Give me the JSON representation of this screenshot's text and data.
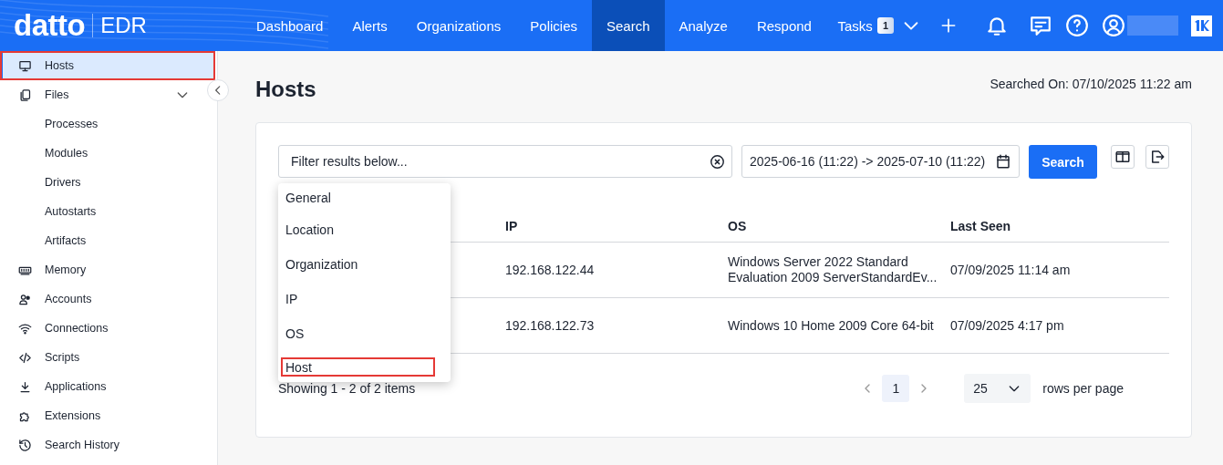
{
  "brand": {
    "logo": "datto",
    "product": "EDR"
  },
  "nav": [
    {
      "label": "Dashboard",
      "selected": false
    },
    {
      "label": "Alerts",
      "selected": false
    },
    {
      "label": "Organizations",
      "selected": false
    },
    {
      "label": "Policies",
      "selected": false
    },
    {
      "label": "Search",
      "selected": true
    },
    {
      "label": "Analyze",
      "selected": false
    },
    {
      "label": "Respond",
      "selected": false
    }
  ],
  "tasks": {
    "label": "Tasks",
    "count": "1"
  },
  "sidebar": {
    "items": [
      {
        "label": "Hosts",
        "selected": true,
        "highlighted": true
      },
      {
        "label": "Files",
        "selected": false,
        "highlighted": false,
        "expanded": true,
        "children": [
          {
            "label": "Processes",
            "selected": false,
            "highlighted": false
          },
          {
            "label": "Modules",
            "selected": false,
            "highlighted": false
          },
          {
            "label": "Drivers",
            "selected": false,
            "highlighted": false
          },
          {
            "label": "Autostarts",
            "selected": false,
            "highlighted": false
          },
          {
            "label": "Artifacts",
            "selected": false,
            "highlighted": false
          }
        ]
      },
      {
        "label": "Memory",
        "selected": false,
        "highlighted": false
      },
      {
        "label": "Accounts",
        "selected": false,
        "highlighted": false
      },
      {
        "label": "Connections",
        "selected": false,
        "highlighted": false
      },
      {
        "label": "Scripts",
        "selected": false,
        "highlighted": false
      },
      {
        "label": "Applications",
        "selected": false,
        "highlighted": false
      },
      {
        "label": "Extensions",
        "selected": false,
        "highlighted": false
      },
      {
        "label": "Search History",
        "selected": false,
        "highlighted": false
      }
    ]
  },
  "page": {
    "title": "Hosts",
    "searched_on": "Searched On: 07/10/2025 11:22 am"
  },
  "filter": {
    "placeholder": "Filter results below...",
    "date_range": "2025-06-16 (11:22) -> 2025-07-10 (11:22)",
    "search_button": "Search"
  },
  "filter_menu": [
    {
      "label": "General",
      "highlighted": false
    },
    {
      "label": "Location",
      "highlighted": false
    },
    {
      "label": "Organization",
      "highlighted": false
    },
    {
      "label": "IP",
      "highlighted": false
    },
    {
      "label": "OS",
      "highlighted": false
    },
    {
      "label": "Host",
      "highlighted": true
    }
  ],
  "table": {
    "columns": [
      "IP",
      "OS",
      "Last Seen"
    ],
    "rows": [
      [
        "192.168.122.44",
        "Windows Server 2022 Standard Evaluation 2009 ServerStandardEv...",
        "07/09/2025 11:14 am"
      ],
      [
        "192.168.122.73",
        "Windows 10 Home 2009 Core 64-bit",
        "07/09/2025 4:17 pm"
      ]
    ]
  },
  "summary": "Showing 1 - 2 of 2 items",
  "pagination": {
    "pages": [
      {
        "label": "1",
        "selected": true
      }
    ],
    "page_size": "25",
    "page_size_label": "rows per page"
  }
}
